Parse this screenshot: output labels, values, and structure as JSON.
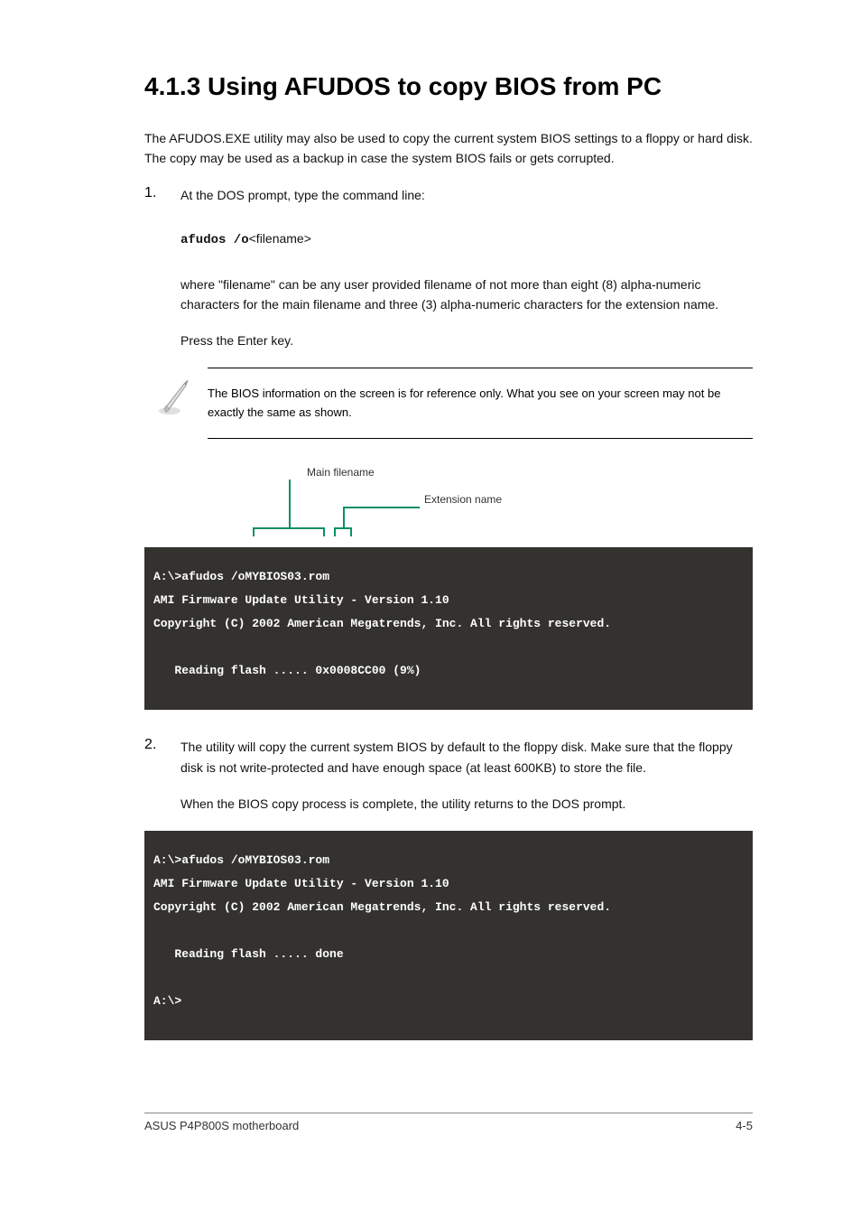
{
  "title": "4.1.3  Using AFUDOS to copy BIOS from PC",
  "intro": "The AFUDOS.EXE utility may also be used to copy the current system BIOS settings to a floppy or hard disk. The copy may be used as a backup in case the system BIOS fails or gets corrupted.",
  "steps": {
    "step1": {
      "num": "1.",
      "text_a": "At the DOS prompt, type the command line:",
      "cmd_prefix": "afudos  /o",
      "cmd_param": "<filename>",
      "desc_a": "where \"filename\" can be any user provided filename of not more than eight (8) alpha-numeric characters for the main filename and three (3) alpha-numeric characters for the extension name.",
      "desc_b": "Press the Enter key."
    },
    "step2": {
      "num": "2.",
      "text": "The utility will copy the current system BIOS by default to the floppy disk. Make sure that the floppy disk is not write-protected and have enough space (at least 600KB) to store the file."
    }
  },
  "note": "The BIOS information on the screen is for reference only. What you see on your screen may not be exactly the same as shown.",
  "annotations": {
    "main": "Main filename",
    "ext": "Extension name"
  },
  "terminal1": {
    "line1": "A:\\>afudos /oMYBIOS03.rom",
    "line2": "AMI Firmware Update Utility - Version 1.10",
    "line3": "Copyright (C) 2002 American Megatrends, Inc. All rights reserved.",
    "line4": "   Reading flash ..... 0x0008CC00 (9%)"
  },
  "terminal2_intro": "When the BIOS copy process is complete, the utility returns to the DOS prompt.",
  "terminal2": {
    "line1": "A:\\>afudos /oMYBIOS03.rom",
    "line2": "AMI Firmware Update Utility - Version 1.10",
    "line3": "Copyright (C) 2002 American Megatrends, Inc. All rights reserved.",
    "line4": "   Reading flash ..... done",
    "line5": "A:\\>"
  },
  "footer": {
    "left": "ASUS P4P800S motherboard",
    "right": "4-5"
  }
}
